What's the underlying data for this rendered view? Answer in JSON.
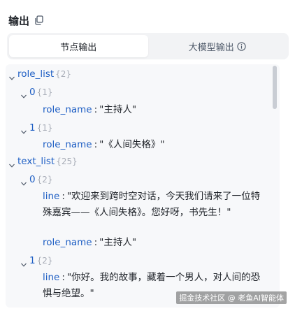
{
  "header": {
    "title": "输出",
    "copy_icon": "copy-icon"
  },
  "tabs": [
    {
      "label": "节点输出",
      "active": true
    },
    {
      "label": "大模型输出",
      "active": false,
      "icon": "info-icon"
    }
  ],
  "tree": {
    "role_list": {
      "key": "role_list",
      "count": "{2}",
      "items": [
        {
          "index": "0",
          "count": "{1}",
          "prop_key": "role_name",
          "prop_value": "\"主持人\""
        },
        {
          "index": "1",
          "count": "{1}",
          "prop_key": "role_name",
          "prop_value": "\"《人间失格》\""
        }
      ]
    },
    "text_list": {
      "key": "text_list",
      "count": "{25}",
      "items": [
        {
          "index": "0",
          "count": "{2}",
          "line_key": "line",
          "line_value": "\"欢迎来到跨时空对话，今天我们请来了一位特殊嘉宾——《人间失格》。您好呀，书先生！\"",
          "prop_key": "role_name",
          "prop_value": "\"主持人\""
        },
        {
          "index": "1",
          "count": "{2}",
          "line_key": "line",
          "line_value": "\"你好。我的故事，藏着一个男人，对人间的恐惧与绝望。\""
        }
      ]
    }
  },
  "colors": {
    "key": "#1f5fc4",
    "count": "#a9aeb8",
    "panel_bg": "#f7f8fa",
    "tab_bg": "#f2f3f5"
  },
  "watermark": "掘金技术社区 @ 老鱼AI智能体"
}
